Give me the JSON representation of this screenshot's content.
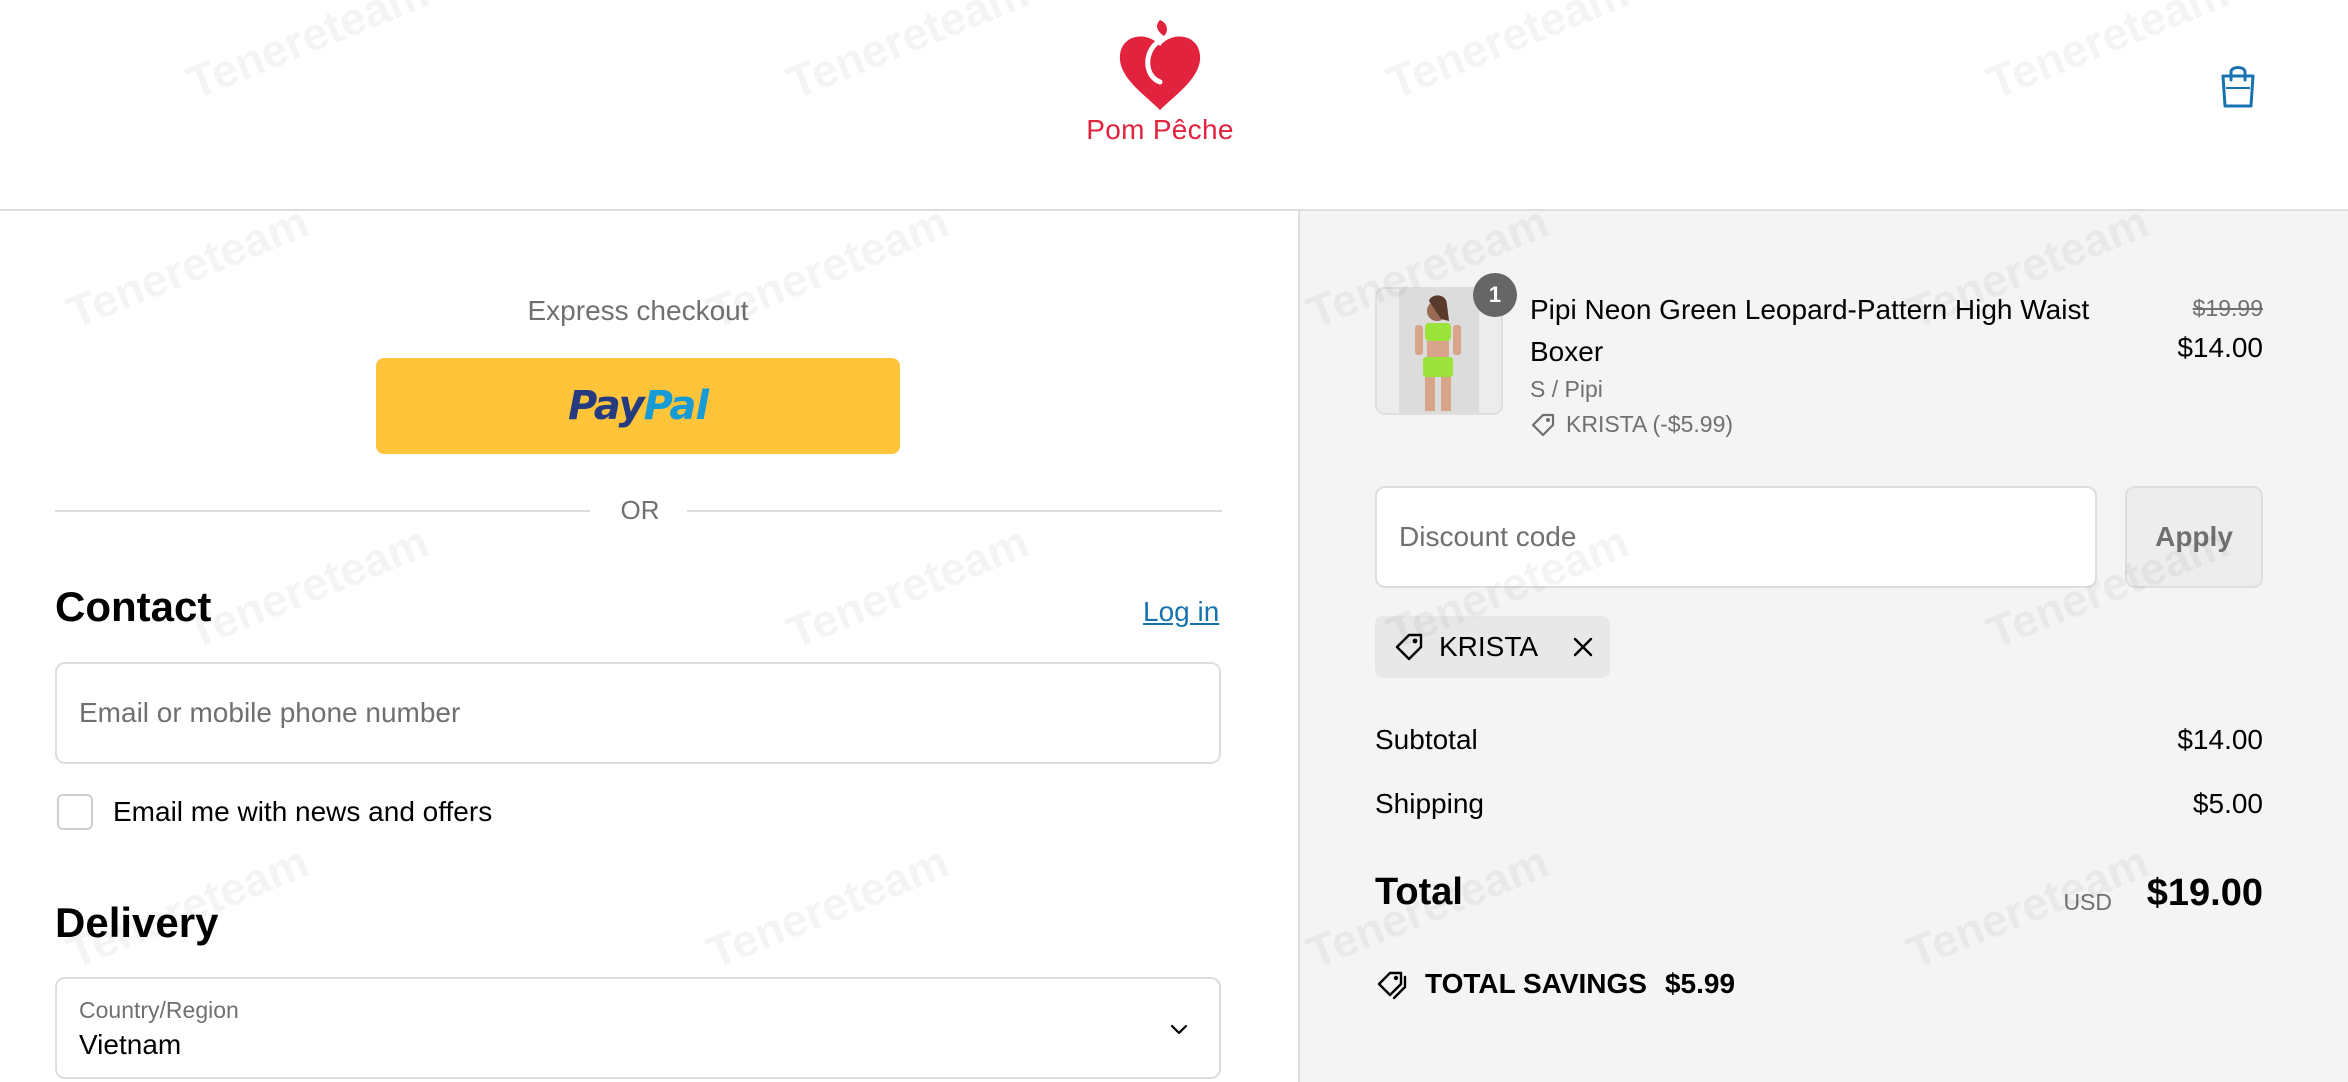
{
  "header": {
    "brand_name": "Pom Pêche",
    "brand_color": "#e2233e",
    "cart_icon": "shopping-bag-icon"
  },
  "express": {
    "label": "Express checkout",
    "paypal_pay": "Pay",
    "paypal_pal": "Pal",
    "paypal_color": "#ffc439",
    "or_text": "OR"
  },
  "contact": {
    "heading": "Contact",
    "login_link": "Log in",
    "email_placeholder": "Email or mobile phone number",
    "newsletter_label": "Email me with news and offers",
    "newsletter_checked": false
  },
  "delivery": {
    "heading": "Delivery",
    "country_label": "Country/Region",
    "country_value": "Vietnam"
  },
  "order": {
    "item": {
      "quantity": "1",
      "name": "Pipi Neon Green Leopard-Pattern High Waist Boxer",
      "variant": "S / Pipi",
      "discount": "KRISTA (-$5.99)",
      "price_original": "$19.99",
      "price": "$14.00"
    },
    "discount_placeholder": "Discount code",
    "apply_label": "Apply",
    "applied_code": "KRISTA",
    "subtotal_label": "Subtotal",
    "subtotal_value": "$14.00",
    "shipping_label": "Shipping",
    "shipping_value": "$5.00",
    "total_label": "Total",
    "total_currency": "USD",
    "total_value": "$19.00",
    "savings_label": "TOTAL SAVINGS",
    "savings_value": "$5.99"
  },
  "watermark_text": "Tenereteam"
}
